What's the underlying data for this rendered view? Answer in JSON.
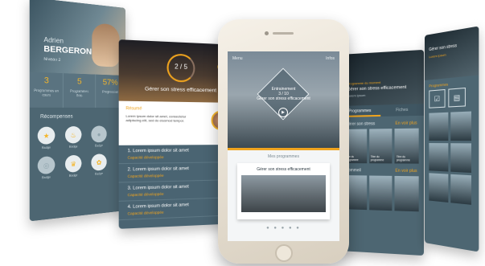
{
  "profile": {
    "first_name": "Adrien",
    "last_name": "BERGERON",
    "level": "Niveau 2",
    "stats": [
      {
        "value": "3",
        "label": "Programmes en cours"
      },
      {
        "value": "5",
        "label": "Programmes finis"
      },
      {
        "value": "57%",
        "label": "Progression"
      }
    ],
    "rewards_title": "Récompenses",
    "badges": [
      {
        "label": "Badge",
        "icon": "star-icon"
      },
      {
        "label": "Badge",
        "icon": "flame-icon"
      },
      {
        "label": "Badge",
        "icon": "medal-icon"
      },
      {
        "label": "Badge",
        "icon": "lock-icon"
      },
      {
        "label": "Badge",
        "icon": "trophy-icon"
      },
      {
        "label": "Badge",
        "icon": "ribbon-icon"
      }
    ]
  },
  "session": {
    "progress": "2 / 5",
    "title": "Gérer son stress efficacement",
    "card_title": "Résumé",
    "card_text": "Lorem ipsum dolor sit amet, consectetur adipiscing elit, sed do eiusmod tempor.",
    "items": [
      {
        "title": "1. Lorem ipsum dolor sit amet",
        "sub": "Capacité développée"
      },
      {
        "title": "2. Lorem ipsum dolor sit amet",
        "sub": "Capacité développée"
      },
      {
        "title": "3. Lorem ipsum dolor sit amet",
        "sub": "Capacité développée"
      },
      {
        "title": "4. Lorem ipsum dolor sit amet",
        "sub": "Capacité développée"
      }
    ]
  },
  "phone": {
    "nav_left": "Menu",
    "nav_right": "Infos",
    "diamond_title": "Entrainement",
    "diamond_progress": "3 / 10",
    "diamond_sub": "Gérer son stress efficacement",
    "section_title": "Mes programmes",
    "card_title": "Gérer son stress efficacement",
    "dots": "● ● ● ● ●"
  },
  "programmes": {
    "kicker": "Programme du moment",
    "title": "Gérer son stress efficacement",
    "subtitle": "Lorem ipsum",
    "tabs": [
      "Programmes",
      "Fiches"
    ],
    "section1": "Gérer son stress",
    "more": "En voir plus",
    "thumbs": [
      "Titre du programme",
      "Titre du programme",
      "Titre du programme"
    ],
    "section2": "Sommeil"
  },
  "far_panel": {
    "title": "Gérer son stress",
    "kicker": "Lorem ipsum",
    "label": "Programmes"
  },
  "colors": {
    "accent": "#f0a41e",
    "panel": "#4d6672",
    "background": "#ffffff"
  }
}
